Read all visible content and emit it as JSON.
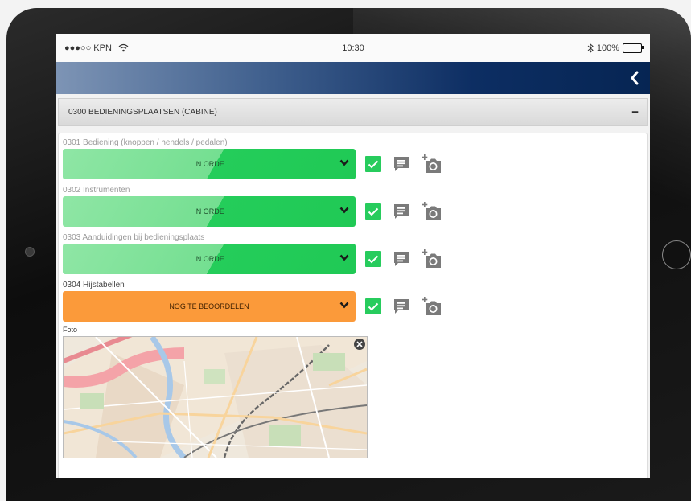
{
  "status_bar": {
    "carrier": "●●●○○ KPN",
    "time": "10:30",
    "battery": "100%",
    "battery_level": 1.0
  },
  "section": {
    "title": "0300 BEDIENINGSPLAATSEN (CABINE)",
    "toggle": "−"
  },
  "items": [
    {
      "label": "0301 Bediening (knoppen / hendels / pedalen)",
      "status": "IN ORDE"
    },
    {
      "label": "0302 Instrumenten",
      "status": "IN ORDE"
    },
    {
      "label": "0303 Aanduidingen bij bedieningsplaats",
      "status": "IN ORDE"
    },
    {
      "label": "0304 Hijstabellen",
      "status": "NOG TE BEOORDELEN"
    }
  ],
  "photo": {
    "label": "Foto"
  },
  "colors": {
    "ok_green": "#20c955",
    "pending_orange": "#fb9a3a",
    "navbar_dark": "#062553",
    "checkbox_green": "#27cc5d"
  },
  "icons": {
    "back": "chevron-left-icon",
    "dropdown": "chevron-down-icon",
    "check": "checkmark-icon",
    "comment": "comment-icon",
    "camera": "add-photo-icon",
    "remove": "close-circle-icon",
    "wifi": "wifi-icon",
    "bluetooth": "bluetooth-icon"
  }
}
